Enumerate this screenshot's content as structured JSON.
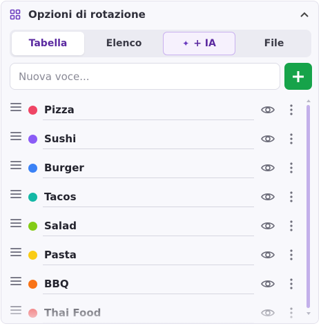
{
  "header": {
    "title": "Opzioni di rotazione",
    "icon": "grid-icon"
  },
  "tabs": [
    {
      "label": "Tabella",
      "active": true
    },
    {
      "label": "Elenco",
      "active": false
    },
    {
      "label": "+ IA",
      "active": false,
      "icon": "sparkles-icon"
    },
    {
      "label": "File",
      "active": false
    }
  ],
  "new_item": {
    "placeholder": "Nuova voce...",
    "value": ""
  },
  "items": [
    {
      "label": "Pizza",
      "color": "#ef4565"
    },
    {
      "label": "Sushi",
      "color": "#8b5cf6"
    },
    {
      "label": "Burger",
      "color": "#3b82f6"
    },
    {
      "label": "Tacos",
      "color": "#14b8a6"
    },
    {
      "label": "Salad",
      "color": "#84cc16"
    },
    {
      "label": "Pasta",
      "color": "#facc15"
    },
    {
      "label": "BBQ",
      "color": "#f97316"
    },
    {
      "label": "Thai Food",
      "color": "#ef4444"
    }
  ],
  "colors": {
    "accent": "#5b2aa0",
    "add_button": "#16a34a",
    "scroll_thumb": "#c3b0ea"
  }
}
